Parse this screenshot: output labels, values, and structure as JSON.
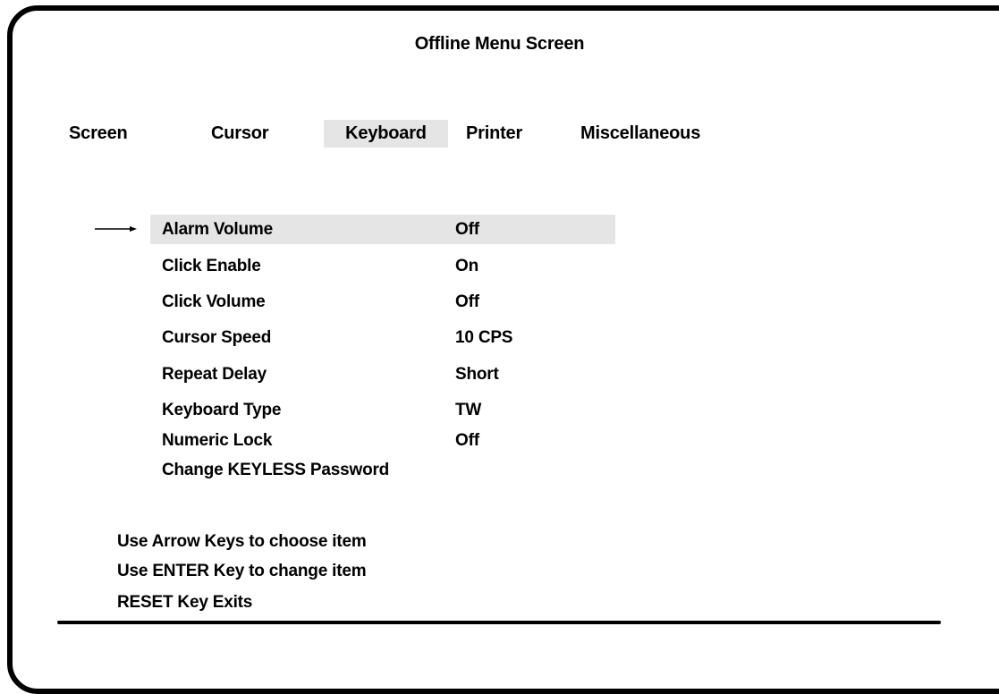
{
  "screen": {
    "title": "Offline Menu Screen"
  },
  "tabs": [
    {
      "label": "Screen",
      "selected": false
    },
    {
      "label": "Cursor",
      "selected": false
    },
    {
      "label": "Keyboard",
      "selected": true
    },
    {
      "label": "Printer",
      "selected": false
    },
    {
      "label": "Miscellaneous",
      "selected": false
    }
  ],
  "menu": {
    "selected_index": 0,
    "items": [
      {
        "label": "Alarm Volume",
        "value": "Off"
      },
      {
        "label": "Click Enable",
        "value": "On"
      },
      {
        "label": "Click Volume",
        "value": "Off"
      },
      {
        "label": "Cursor Speed",
        "value": "10 CPS"
      },
      {
        "label": "Repeat Delay",
        "value": "Short"
      },
      {
        "label": "Keyboard Type",
        "value": "TW"
      },
      {
        "label": "Numeric Lock",
        "value": "Off"
      },
      {
        "label": "Change KEYLESS Password",
        "value": ""
      }
    ]
  },
  "help": {
    "line1": "Use Arrow Keys to choose item",
    "line2": "Use ENTER Key to change item",
    "line3": "RESET Key Exits"
  },
  "colors": {
    "highlight": "#e5e5e5",
    "text": "#000000",
    "background": "#ffffff"
  },
  "icons": {
    "selection_pointer": "right-arrow-icon"
  }
}
